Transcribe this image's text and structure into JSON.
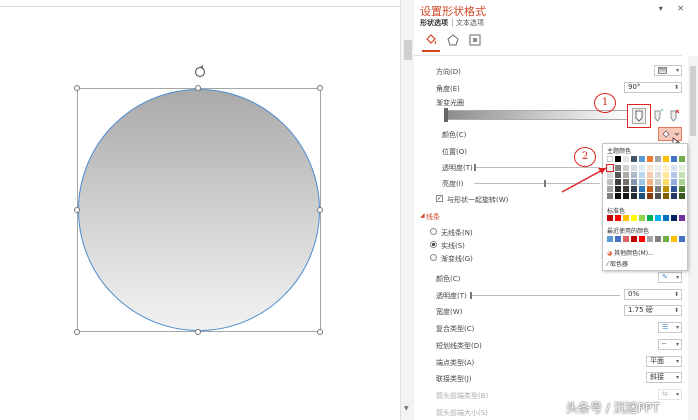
{
  "pane": {
    "title": "设置形状格式",
    "tabs": [
      "形状选项",
      "文本选项"
    ],
    "window_controls": "▾ ✕",
    "fill": {
      "direction_label": "方向(D)",
      "angle_label": "角度(E)",
      "angle_value": "90°",
      "gradient_stops_label": "渐变光圈",
      "color_label": "颜色(C)",
      "position_label": "位置(O)",
      "transparency_label": "透明度(T)",
      "brightness_label": "亮度(I)",
      "rotate_with_shape_label": "与形状一起旋转(W)"
    },
    "line": {
      "section_title": "线条",
      "options": [
        "无线条(N)",
        "实线(S)",
        "渐变线(G)"
      ],
      "selected_option": "实线(S)",
      "color_label": "颜色(C)",
      "transparency_label": "透明度(T)",
      "transparency_value": "0%",
      "width_label": "宽度(W)",
      "width_value": "1.75 磅",
      "compound_label": "复合类型(C)",
      "dash_label": "短划线类型(D)",
      "cap_label": "端点类型(A)",
      "cap_value": "平面",
      "join_label": "联接类型(J)",
      "join_value": "斜接",
      "begin_arrow_type_label": "箭头前端类型(B)",
      "begin_arrow_size_label": "箭头前端大小(S)"
    },
    "color_popup": {
      "theme_colors_label": "主题颜色",
      "standard_colors_label": "标准色",
      "recent_colors_label": "最近使用的颜色",
      "more_colors_label": "其他颜色(M)...",
      "eyedropper_label": "取色器",
      "theme_top_row": [
        "#ffffff",
        "#000000",
        "#e7e6e6",
        "#44546a",
        "#5b9bd5",
        "#ed7d31",
        "#a5a5a5",
        "#ffc000",
        "#4472c4",
        "#70ad47"
      ],
      "theme_column_shades": [
        [
          "#f2f2f2",
          "#d9d9d9",
          "#bfbfbf",
          "#a6a6a6",
          "#808080"
        ],
        [
          "#808080",
          "#595959",
          "#404040",
          "#262626",
          "#0d0d0d"
        ],
        [
          "#d0cece",
          "#aeabab",
          "#757171",
          "#3a3838",
          "#171616"
        ],
        [
          "#d6dce4",
          "#adb9ca",
          "#8497b0",
          "#333f4f",
          "#222a35"
        ],
        [
          "#ddebf7",
          "#bdd7ee",
          "#9dc3e6",
          "#2e75b6",
          "#1f4e79"
        ],
        [
          "#fbe5d6",
          "#f8cbad",
          "#f4b183",
          "#c55a11",
          "#843c0c"
        ],
        [
          "#ededed",
          "#dbdbdb",
          "#c9c9c9",
          "#7b7b7b",
          "#525252"
        ],
        [
          "#fff2cc",
          "#ffe699",
          "#ffd966",
          "#bf9000",
          "#7f6000"
        ],
        [
          "#dae3f3",
          "#b4c7e7",
          "#8faadc",
          "#2f5597",
          "#203864"
        ],
        [
          "#e2f0d9",
          "#c5e0b4",
          "#a9d18e",
          "#548235",
          "#385723"
        ]
      ],
      "standard": [
        "#c00000",
        "#ff0000",
        "#ffc000",
        "#ffff00",
        "#92d050",
        "#00b050",
        "#00b0f0",
        "#0070c0",
        "#002060",
        "#7030a0"
      ],
      "recent": [
        "#5b9bd5",
        "#4472c4",
        "#e06666",
        "#c00000",
        "#ff0000",
        "#a9a9a9",
        "#808080",
        "#70ad47",
        "#ffc000",
        "#4472c4"
      ]
    }
  },
  "annotations": {
    "one": "1",
    "two": "2"
  },
  "watermark": "头条号 / 沉迷PPT",
  "colors": {
    "accent": "#d24726",
    "circle_outline": "#4a8bd1",
    "annotation": "#e02020"
  }
}
